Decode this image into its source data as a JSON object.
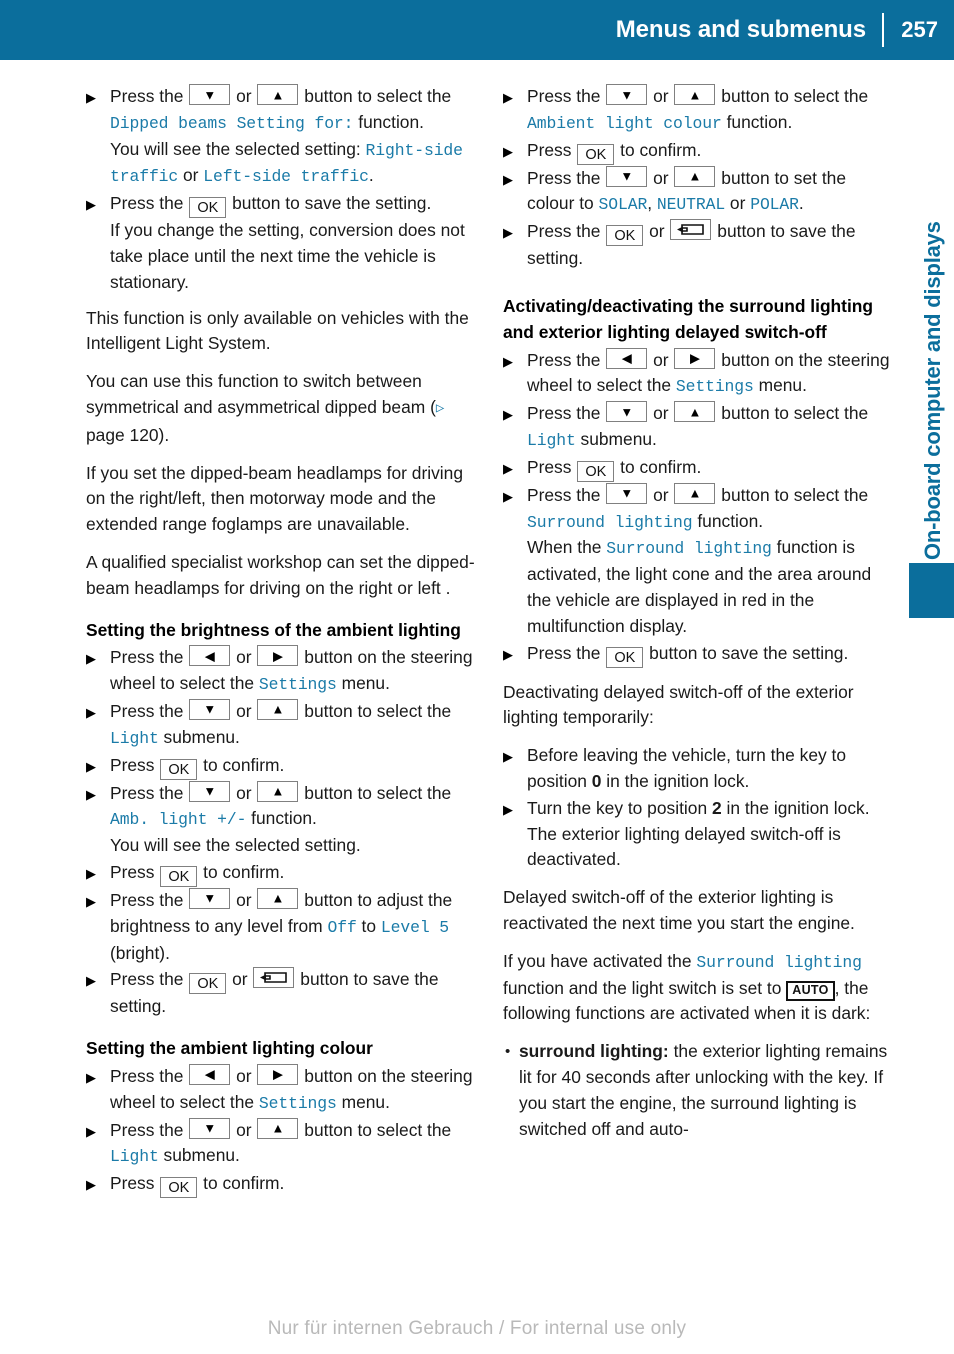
{
  "header": {
    "title": "Menus and submenus",
    "page_number": "257"
  },
  "side_tab": {
    "label": "On-board computer and displays",
    "accent_color": "#0b6e9c"
  },
  "footer": {
    "text": "Nur für internen Gebrauch / For internal use only"
  },
  "keys": {
    "down": "▼",
    "up": "▲",
    "left": "◀",
    "right": "▶",
    "ok": "OK",
    "auto": "AUTO",
    "pageref": "▷"
  },
  "colors": {
    "menu_text": "#1b7ba8",
    "header_bg": "#0b6e9c",
    "body_text": "#1a1a1a"
  },
  "left_column": {
    "step1": {
      "t1": "Press the ",
      "t2": " or ",
      "t3": " button to select the ",
      "m1": "Dipped beams Setting for:",
      "t4": " function.",
      "t5": "You will see the selected setting: ",
      "m2": "Right-side traffic",
      "t6": " or ",
      "m3": "Left-side traffic",
      "t7": "."
    },
    "step2": {
      "t1": "Press the ",
      "t2": " button to save the setting.",
      "t3": "If you change the setting, conversion does not take place until the next time the vehicle is stationary."
    },
    "para1": "This function is only available on vehicles with the Intelligent Light System.",
    "para2_a": "You can use this function to switch between symmetrical and asymmetrical dipped beam (",
    "para2_b": " page 120).",
    "para3": "If you set the dipped-beam headlamps for driving on the right/left, then motorway mode and the extended range foglamps are unavailable.",
    "para4": "A qualified specialist workshop can set the dipped-beam headlamps for driving on the right or left .",
    "heading1": "Setting the brightness of the ambient lighting",
    "step3": {
      "t1": "Press the ",
      "t2": " or ",
      "t3": " button on the steering wheel to select the ",
      "m1": "Settings",
      "t4": " menu."
    },
    "step4": {
      "t1": "Press the ",
      "t2": " or ",
      "t3": " button to select the ",
      "m1": "Light",
      "t4": " submenu."
    },
    "step5": {
      "t1": "Press ",
      "t2": " to confirm."
    },
    "step6": {
      "t1": "Press the ",
      "t2": " or ",
      "t3": " button to select the ",
      "m1": "Amb. light +/-",
      "t4": " function.",
      "t5": "You will see the selected setting."
    },
    "step7": {
      "t1": "Press ",
      "t2": " to confirm."
    },
    "step8": {
      "t1": "Press the ",
      "t2": " or ",
      "t3": " button to adjust the brightness to any level from ",
      "m1": "Off",
      "t4": " to ",
      "m2": "Level 5",
      "t5": " (bright)."
    },
    "step9": {
      "t1": "Press the ",
      "t2": " or ",
      "t3": " button to save the setting."
    },
    "heading2": "Setting the ambient lighting colour",
    "step10": {
      "t1": "Press the ",
      "t2": " or ",
      "t3": " button on the steering wheel to select the ",
      "m1": "Settings",
      "t4": " menu."
    },
    "step11": {
      "t1": "Press the ",
      "t2": " or ",
      "t3": " button to select the ",
      "m1": "Light",
      "t4": " submenu."
    },
    "step12": {
      "t1": "Press ",
      "t2": " to confirm."
    }
  },
  "right_column": {
    "step1": {
      "t1": "Press the ",
      "t2": " or ",
      "t3": " button to select the ",
      "m1": "Ambient light colour",
      "t4": " function."
    },
    "step2": {
      "t1": "Press ",
      "t2": " to confirm."
    },
    "step3": {
      "t1": "Press the ",
      "t2": " or ",
      "t3": " button to set the colour to ",
      "m1": "SOLAR",
      "t4": ", ",
      "m2": "NEUTRAL",
      "t5": " or ",
      "m3": "POLAR",
      "t6": "."
    },
    "step4": {
      "t1": "Press the ",
      "t2": " or ",
      "t3": " button to save the setting."
    },
    "heading1": "Activating/deactivating the surround lighting and exterior lighting delayed switch-off",
    "step5": {
      "t1": "Press the ",
      "t2": " or ",
      "t3": " button on the steering wheel to select the ",
      "m1": "Settings",
      "t4": " menu."
    },
    "step6": {
      "t1": "Press the ",
      "t2": " or ",
      "t3": " button to select the ",
      "m1": "Light",
      "t4": " submenu."
    },
    "step7": {
      "t1": "Press ",
      "t2": " to confirm."
    },
    "step8": {
      "t1": "Press the ",
      "t2": " or ",
      "t3": " button to select the ",
      "m1": "Surround lighting",
      "t4": " function.",
      "t5": "When the ",
      "m2": "Surround lighting",
      "t6": " function is activated, the light cone and the area around the vehicle are displayed in red in the multifunction display."
    },
    "step9": {
      "t1": "Press the ",
      "t2": " button to save the setting."
    },
    "para1": "Deactivating delayed switch-off of the exterior lighting temporarily:",
    "step10": {
      "t1": "Before leaving the vehicle, turn the key to position ",
      "b1": "0",
      "t2": " in the ignition lock."
    },
    "step11": {
      "t1": "Turn the key to position ",
      "b1": "2",
      "t2": " in the ignition lock.",
      "t3": "The exterior lighting delayed switch-off is deactivated."
    },
    "para2": "Delayed switch-off of the exterior lighting is reactivated the next time you start the engine.",
    "para3_a": "If you have activated the ",
    "para3_m": "Surround lighting",
    "para3_b": " function and the light switch is set to ",
    "para3_c": ", the following functions are activated when it is dark:",
    "bullet1_b": "surround lighting:",
    "bullet1_t": " the exterior lighting remains lit for 40 seconds after unlocking with the key. If you start the engine, the surround lighting is switched off and auto-"
  }
}
